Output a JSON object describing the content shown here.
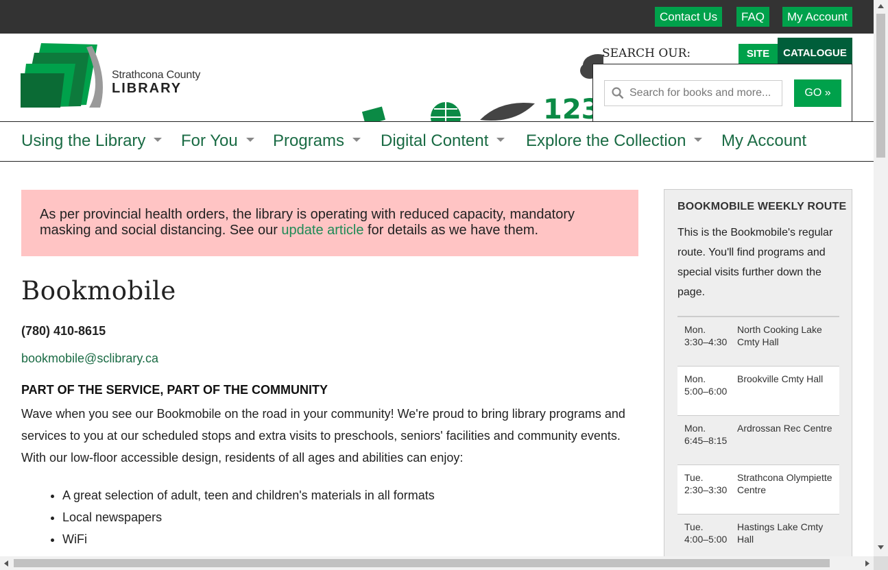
{
  "topbar": {
    "links": [
      "Contact Us",
      "FAQ",
      "My Account"
    ]
  },
  "header": {
    "logo_line1": "Strathcona County",
    "logo_line2": "LIBRARY",
    "search_label": "SEARCH OUR:",
    "tab_site": "SITE",
    "tab_catalogue": "CATALOGUE",
    "search_placeholder": "Search for books and more...",
    "go_label": "GO »"
  },
  "nav": {
    "items": [
      "Using the Library",
      "For You",
      "Programs",
      "Digital Content",
      "Explore the Collection",
      "My Account"
    ]
  },
  "alert": {
    "text_before": "As per provincial health orders, the library is operating with reduced capacity, mandatory masking and social distancing. See our ",
    "link": "update article",
    "text_after": " for details as we have them."
  },
  "main": {
    "title": "Bookmobile",
    "phone": "(780) 410-8615",
    "email": "bookmobile@sclibrary.ca",
    "subheading": "PART OF THE SERVICE, PART OF THE COMMUNITY",
    "body": "Wave when you see our Bookmobile on the road in your community! We're proud to bring library programs and services to you at our scheduled stops and extra visits to preschools, seniors' facilities and community events. With our low-floor accessible design, residents of all ages and abilities can enjoy:",
    "bullets": [
      "A great selection of adult, teen and children's materials in all formats",
      "Local newspapers",
      "WiFi"
    ]
  },
  "sidebar": {
    "title": "BOOKMOBILE WEEKLY ROUTE",
    "desc": "This is the Bookmobile's regular route. You'll find programs and special visits further down the page.",
    "route": [
      {
        "day": "Mon.",
        "time": "3:30–4:30",
        "place": "North Cooking Lake Cmty Hall"
      },
      {
        "day": "Mon.",
        "time": "5:00–6:00",
        "place": "Brookville Cmty Hall"
      },
      {
        "day": "Mon.",
        "time": "6:45–8:15",
        "place": "Ardrossan Rec Centre"
      },
      {
        "day": "Tue.",
        "time": "2:30–3:30",
        "place": "Strathcona Olympiette Centre"
      },
      {
        "day": "Tue.",
        "time": "4:00–5:00",
        "place": "Hastings Lake Cmty Hall"
      }
    ]
  },
  "colors": {
    "brand_green": "#00a14b",
    "dark_green": "#005e3a",
    "nav_green": "#1a6b44",
    "alert_bg": "#ffc4c4"
  }
}
